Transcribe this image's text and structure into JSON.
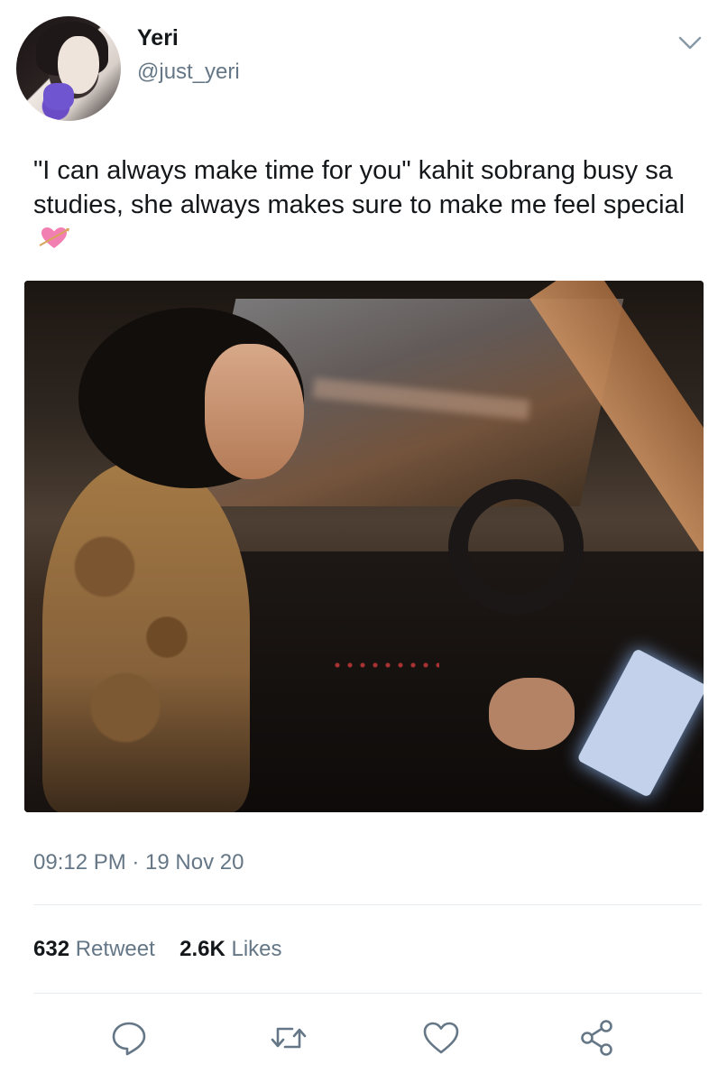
{
  "tweet": {
    "author_name": "Yeri",
    "author_handle": "@just_yeri",
    "text": "\"I can always make time for you\" kahit sobrang busy sa studies, she always makes sure to make me feel special",
    "emoji_icon": "heart-with-arrow-icon",
    "media_icon": "video-thumbnail",
    "timestamp": "09:12 PM · 19 Nov 20"
  },
  "stats": {
    "retweets_count": "632",
    "retweets_label": "Retweet",
    "likes_count": "2.6K",
    "likes_label": "Likes"
  },
  "actions": [
    {
      "name": "reply",
      "icon": "comment-icon"
    },
    {
      "name": "retweet",
      "icon": "retweet-icon"
    },
    {
      "name": "like",
      "icon": "heart-icon"
    },
    {
      "name": "share",
      "icon": "share-icon"
    }
  ],
  "colors": {
    "text": "#14171a",
    "secondary": "#657786",
    "icon": "#657786",
    "divider": "#e6ecf0",
    "emoji_pink": "#f27fb2"
  }
}
